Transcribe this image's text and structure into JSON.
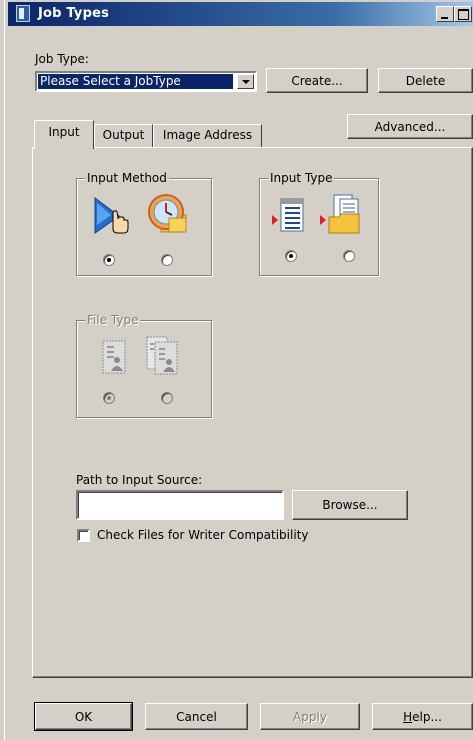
{
  "window": {
    "title": "Job Types"
  },
  "job_type": {
    "label": "Job Type:",
    "selected": "Please Select  a JobType",
    "create_label": "Create...",
    "delete_label": "Delete"
  },
  "advanced_label": "Advanced...",
  "tabs": [
    {
      "label": "Input",
      "active": true
    },
    {
      "label": "Output",
      "active": false
    },
    {
      "label": "Image Address",
      "active": false
    }
  ],
  "input_method": {
    "title": "Input Method",
    "options": [
      {
        "icon": "pointer-hand-icon",
        "checked": true
      },
      {
        "icon": "clock-folder-icon",
        "checked": false
      }
    ]
  },
  "input_type": {
    "title": "Input Type",
    "options": [
      {
        "icon": "document-list-icon",
        "checked": true
      },
      {
        "icon": "folder-documents-icon",
        "checked": false
      }
    ]
  },
  "file_type": {
    "title": "File Type",
    "disabled": true,
    "options": [
      {
        "icon": "single-file-image-icon",
        "checked": true
      },
      {
        "icon": "multi-file-image-icon",
        "checked": false
      }
    ]
  },
  "path": {
    "label": "Path to Input Source:",
    "value": "",
    "browse_label": "Browse..."
  },
  "check_files": {
    "label": "Check Files for Writer Compatibility",
    "checked": false
  },
  "footer": {
    "ok_label": "OK",
    "cancel_label": "Cancel",
    "apply_label": "Apply",
    "help_label": "Help...",
    "help_mnemonic": "H",
    "help_rest": "elp..."
  }
}
